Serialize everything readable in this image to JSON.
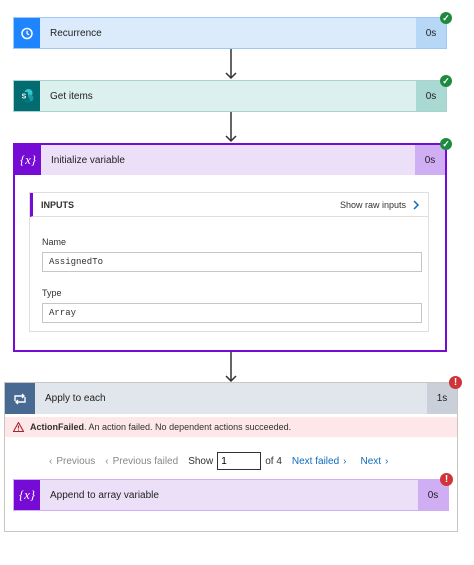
{
  "steps": {
    "recurrence": {
      "title": "Recurrence",
      "duration": "0s",
      "status": "succeeded",
      "accent": "#0f6cbd"
    },
    "get_items": {
      "title": "Get items",
      "duration": "0s",
      "status": "succeeded",
      "accent": "#036c70"
    },
    "init_var": {
      "title": "Initialize variable",
      "duration": "0s",
      "status": "succeeded",
      "accent": "#770bd6",
      "inputs_label": "INPUTS",
      "show_raw_label": "Show raw inputs",
      "name_label": "Name",
      "name_value": "AssignedTo",
      "type_label": "Type",
      "type_value": "Array"
    },
    "apply_each": {
      "title": "Apply to each",
      "duration": "1s",
      "status": "failed",
      "error_title": "ActionFailed",
      "error_text": ". An action failed. No dependent actions succeeded.",
      "pagination": {
        "previous": "Previous",
        "previous_failed": "Previous failed",
        "show": "Show",
        "page_value": "1",
        "of_label": "of 4",
        "next_failed": "Next failed",
        "next": "Next"
      }
    },
    "append": {
      "title": "Append to array variable",
      "duration": "0s",
      "status": "failed",
      "accent": "#770bd6"
    }
  },
  "icons": {
    "recurrence": "alarm-clock-icon",
    "get_items": "sharepoint-icon",
    "init_var": "variable-icon",
    "apply_each": "loop-icon",
    "success": "checkmark-icon",
    "error": "exclamation-icon",
    "warning": "warning-triangle-icon"
  }
}
